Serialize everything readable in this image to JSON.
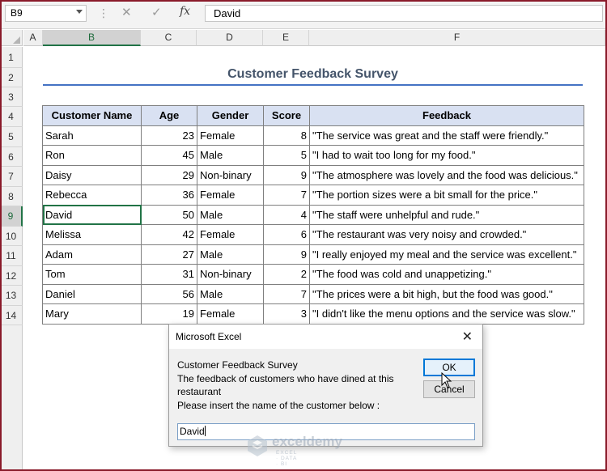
{
  "formula_bar": {
    "name_box": "B9",
    "cancel_icon": "✕",
    "enter_icon": "✓",
    "fx_label": "fx",
    "formula_value": "David"
  },
  "columns": [
    "A",
    "B",
    "C",
    "D",
    "E",
    "F"
  ],
  "selected_column": "B",
  "rows": [
    "1",
    "2",
    "3",
    "4",
    "5",
    "6",
    "7",
    "8",
    "9",
    "10",
    "11",
    "12",
    "13",
    "14"
  ],
  "selected_row": "9",
  "sheet": {
    "title": "Customer Feedback Survey",
    "headers": [
      "Customer Name",
      "Age",
      "Gender",
      "Score",
      "Feedback"
    ],
    "records": [
      {
        "name": "Sarah",
        "age": "23",
        "gender": "Female",
        "score": "8",
        "feedback": "\"The service was great and the staff were friendly.\""
      },
      {
        "name": "Ron",
        "age": "45",
        "gender": "Male",
        "score": "5",
        "feedback": "\"I had to wait too long for my food.\""
      },
      {
        "name": "Daisy",
        "age": "29",
        "gender": "Non-binary",
        "score": "9",
        "feedback": "\"The atmosphere was lovely and the food was delicious.\""
      },
      {
        "name": "Rebecca",
        "age": "36",
        "gender": "Female",
        "score": "7",
        "feedback": "\"The portion sizes were a bit small for the price.\""
      },
      {
        "name": "David",
        "age": "50",
        "gender": "Male",
        "score": "4",
        "feedback": "\"The staff were unhelpful and rude.\""
      },
      {
        "name": "Melissa",
        "age": "42",
        "gender": "Female",
        "score": "6",
        "feedback": "\"The restaurant was very noisy and crowded.\""
      },
      {
        "name": "Adam",
        "age": "27",
        "gender": "Male",
        "score": "9",
        "feedback": "\"I really enjoyed my meal and the service was excellent.\""
      },
      {
        "name": "Tom",
        "age": "31",
        "gender": "Non-binary",
        "score": "2",
        "feedback": "\"The food was cold and unappetizing.\""
      },
      {
        "name": "Daniel",
        "age": "56",
        "gender": "Male",
        "score": "7",
        "feedback": "\"The prices were a bit high, but the food was good.\""
      },
      {
        "name": "Mary",
        "age": "19",
        "gender": "Female",
        "score": "3",
        "feedback": "\"I didn't like the menu options and the service was slow.\""
      }
    ]
  },
  "dialog": {
    "title": "Microsoft Excel",
    "close_icon": "✕",
    "prompt_lines": [
      "Customer Feedback Survey",
      "The feedback of customers who have dined at this restaurant",
      "Please insert the name of the customer below :"
    ],
    "ok_label": "OK",
    "cancel_label": "Cancel",
    "input_value": "David"
  },
  "watermark": {
    "name": "exceldemy",
    "tagline": "EXCEL · DATA · BI"
  },
  "colors": {
    "header_fill": "#d9e1f2",
    "title_color": "#44546a",
    "title_underline": "#4472c4",
    "selection_green": "#217346",
    "window_border": "#8a1a2a"
  }
}
